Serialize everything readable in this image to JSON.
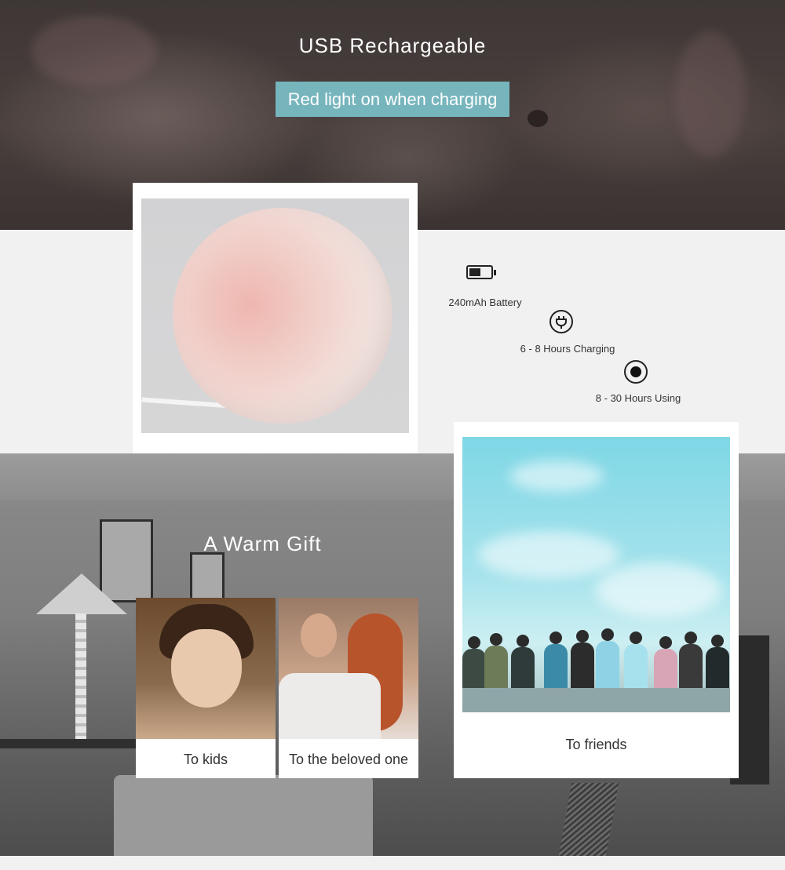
{
  "header": {
    "title": "USB Rechargeable",
    "badge": "Red light on when charging"
  },
  "specs": [
    {
      "icon": "battery-icon",
      "label": "240mAh Battery"
    },
    {
      "icon": "plug-icon",
      "label": "6 - 8 Hours Charging"
    },
    {
      "icon": "record-icon",
      "label": "8 - 30 Hours Using"
    }
  ],
  "gift": {
    "title": "A Warm Gift",
    "cards": [
      {
        "caption": "To kids"
      },
      {
        "caption": "To the beloved one"
      },
      {
        "caption": "To friends"
      }
    ]
  },
  "colors": {
    "badge_bg": "#77b5bd",
    "card_bg": "#ffffff",
    "page_bg": "#f2f1f2"
  }
}
